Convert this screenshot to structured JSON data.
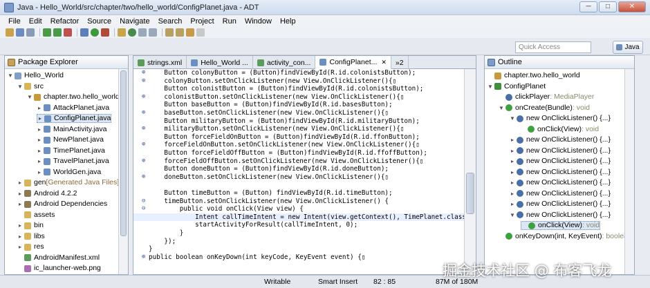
{
  "window": {
    "title": "Java - Hello_World/src/chapter/two/hello_world/ConfigPlanet.java - ADT",
    "controls": [
      "─",
      "□",
      "✕"
    ]
  },
  "menu": [
    "File",
    "Edit",
    "Refactor",
    "Source",
    "Navigate",
    "Search",
    "Project",
    "Run",
    "Window",
    "Help"
  ],
  "quick_access": {
    "placeholder": "Quick Access"
  },
  "perspective": {
    "label": "Java"
  },
  "package_explorer": {
    "title": "Package Explorer",
    "items": [
      {
        "label": "Hello_World",
        "depth": 0,
        "icon": "project-icon",
        "arrow": "▼"
      },
      {
        "label": "src",
        "depth": 1,
        "icon": "folder-icon",
        "arrow": "▼"
      },
      {
        "label": "chapter.two.hello_world",
        "depth": 2,
        "icon": "package-icon",
        "arrow": "▼"
      },
      {
        "label": "AttackPlanet.java",
        "depth": 3,
        "icon": "java-file-icon",
        "arrow": "▸"
      },
      {
        "label": "ConfigPlanet.java",
        "depth": 3,
        "icon": "java-file-icon",
        "arrow": "▸",
        "selected": true
      },
      {
        "label": "MainActivity.java",
        "depth": 3,
        "icon": "java-file-icon",
        "arrow": "▸"
      },
      {
        "label": "NewPlanet.java",
        "depth": 3,
        "icon": "java-file-icon",
        "arrow": "▸"
      },
      {
        "label": "TimePlanet.java",
        "depth": 3,
        "icon": "java-file-icon",
        "arrow": "▸"
      },
      {
        "label": "TravelPlanet.java",
        "depth": 3,
        "icon": "java-file-icon",
        "arrow": "▸"
      },
      {
        "label": "WorldGen.java",
        "depth": 3,
        "icon": "java-file-icon",
        "arrow": "▸"
      },
      {
        "label": "gen",
        "suffix": " [Generated Java Files]",
        "depth": 1,
        "icon": "folder-icon",
        "arrow": "▸"
      },
      {
        "label": "Android 4.2.2",
        "depth": 1,
        "icon": "library-icon",
        "arrow": "▸"
      },
      {
        "label": "Android Dependencies",
        "depth": 1,
        "icon": "library-icon",
        "arrow": "▸"
      },
      {
        "label": "assets",
        "depth": 1,
        "icon": "folder-icon",
        "arrow": ""
      },
      {
        "label": "bin",
        "depth": 1,
        "icon": "folder-icon",
        "arrow": "▸"
      },
      {
        "label": "libs",
        "depth": 1,
        "icon": "folder-icon",
        "arrow": "▸"
      },
      {
        "label": "res",
        "depth": 1,
        "icon": "folder-icon",
        "arrow": "▸"
      },
      {
        "label": "AndroidManifest.xml",
        "depth": 1,
        "icon": "xml-file-icon",
        "arrow": ""
      },
      {
        "label": "ic_launcher-web.png",
        "depth": 1,
        "icon": "image-file-icon",
        "arrow": ""
      }
    ]
  },
  "editor": {
    "tabs": [
      {
        "label": "strings.xml",
        "active": false
      },
      {
        "label": "Hello_World ...",
        "active": false
      },
      {
        "label": "activity_con...",
        "active": false
      },
      {
        "label": "ConfigPlanet...",
        "active": true
      },
      {
        "label": "»2",
        "active": false
      }
    ],
    "lines": [
      {
        "g": "⊕",
        "code": "    Button colonyButton = (Button)findViewById(R.id.colonistsButton);"
      },
      {
        "g": "⊕",
        "code": "    colonyButton.setOnClickListener(new View.OnClickListener(){▯"
      },
      {
        "g": "",
        "code": "    Button colonistButton = (Button)findViewById(R.id.colonistsButton);"
      },
      {
        "g": "⊕",
        "code": "    colonistButton.setOnClickListener(new View.OnClickListener(){▯"
      },
      {
        "g": "",
        "code": "    Button baseButton = (Button)findViewById(R.id.basesButton);"
      },
      {
        "g": "⊕",
        "code": "    baseButton.setOnClickListener(new View.OnClickListener(){▯"
      },
      {
        "g": "",
        "code": "    Button militaryButton = (Button)findViewById(R.id.militaryButton);"
      },
      {
        "g": "⊕",
        "code": "    militaryButton.setOnClickListener(new View.OnClickListener(){▯"
      },
      {
        "g": "",
        "code": "    Button forceFieldOnButton = (Button)findViewById(R.id.ffonButton);"
      },
      {
        "g": "⊕",
        "code": "    forceFieldOnButton.setOnClickListener(new View.OnClickListener(){▯"
      },
      {
        "g": "",
        "code": "    Button forceFieldOffButton = (Button)findViewById(R.id.ffoffButton);"
      },
      {
        "g": "⊕",
        "code": "    forceFieldOffButton.setOnClickListener(new View.OnClickListener(){▯"
      },
      {
        "g": "",
        "code": "    Button doneButton = (Button)findViewById(R.id.doneButton);"
      },
      {
        "g": "⊕",
        "code": "    doneButton.setOnClickListener(new View.OnClickListener(){▯"
      },
      {
        "g": "",
        "code": ""
      },
      {
        "g": "",
        "code": "    Button timeButton = (Button) findViewById(R.id.timeButton);"
      },
      {
        "g": "⊖",
        "code": "    timeButton.setOnClickListener(new View.OnClickListener() {"
      },
      {
        "g": "⊖",
        "code": "        public void onClick(View view) {"
      },
      {
        "g": "",
        "code": "            Intent callTimeIntent = new Intent(view.getContext(), TimePlanet.class);",
        "hl": true
      },
      {
        "g": "",
        "code": "            startActivityForResult(callTimeIntent, 0);"
      },
      {
        "g": "",
        "code": "        }"
      },
      {
        "g": "",
        "code": "    });"
      },
      {
        "g": "",
        "code": "}"
      },
      {
        "g": "⊕",
        "code": "public boolean onKeyDown(int keyCode, KeyEvent event) {▯"
      }
    ]
  },
  "outline": {
    "title": "Outline",
    "items": [
      {
        "label": "chapter.two.hello_world",
        "type": "",
        "depth": 0,
        "arrow": ""
      },
      {
        "label": "ConfigPlanet",
        "type": "",
        "depth": 0,
        "arrow": "▼"
      },
      {
        "label": "clickPlayer",
        "type": " : MediaPlayer",
        "depth": 1,
        "arrow": ""
      },
      {
        "label": "onCreate(Bundle)",
        "type": " : void",
        "depth": 1,
        "arrow": "▼"
      },
      {
        "label": "new OnClickListener() {...}",
        "type": "",
        "depth": 2,
        "arrow": "▼"
      },
      {
        "label": "onClick(View)",
        "type": " : void",
        "depth": 3,
        "arrow": ""
      },
      {
        "label": "new OnClickListener() {...}",
        "type": "",
        "depth": 2,
        "arrow": "▸"
      },
      {
        "label": "new OnClickListener() {...}",
        "type": "",
        "depth": 2,
        "arrow": "▸"
      },
      {
        "label": "new OnClickListener() {...}",
        "type": "",
        "depth": 2,
        "arrow": "▸"
      },
      {
        "label": "new OnClickListener() {...}",
        "type": "",
        "depth": 2,
        "arrow": "▸"
      },
      {
        "label": "new OnClickListener() {...}",
        "type": "",
        "depth": 2,
        "arrow": "▸"
      },
      {
        "label": "new OnClickListener() {...}",
        "type": "",
        "depth": 2,
        "arrow": "▸"
      },
      {
        "label": "new OnClickListener() {...}",
        "type": "",
        "depth": 2,
        "arrow": "▸"
      },
      {
        "label": "new OnClickListener() {...}",
        "type": "",
        "depth": 2,
        "arrow": "▼"
      },
      {
        "label": "onClick(View)",
        "type": " : void",
        "depth": 3,
        "arrow": "",
        "selected": true
      },
      {
        "label": "onKeyDown(int, KeyEvent)",
        "type": " : boolean",
        "depth": 1,
        "arrow": ""
      }
    ]
  },
  "status": {
    "mode": "Writable",
    "insert": "Smart Insert",
    "position": "82 : 85",
    "memory": "87M of 180M"
  },
  "watermark": "掘金技术社区 @ 布客飞龙",
  "colors": {
    "keyword": "#7f0055",
    "italic_field": "#0000c0",
    "selection": "#dbe6f4"
  }
}
